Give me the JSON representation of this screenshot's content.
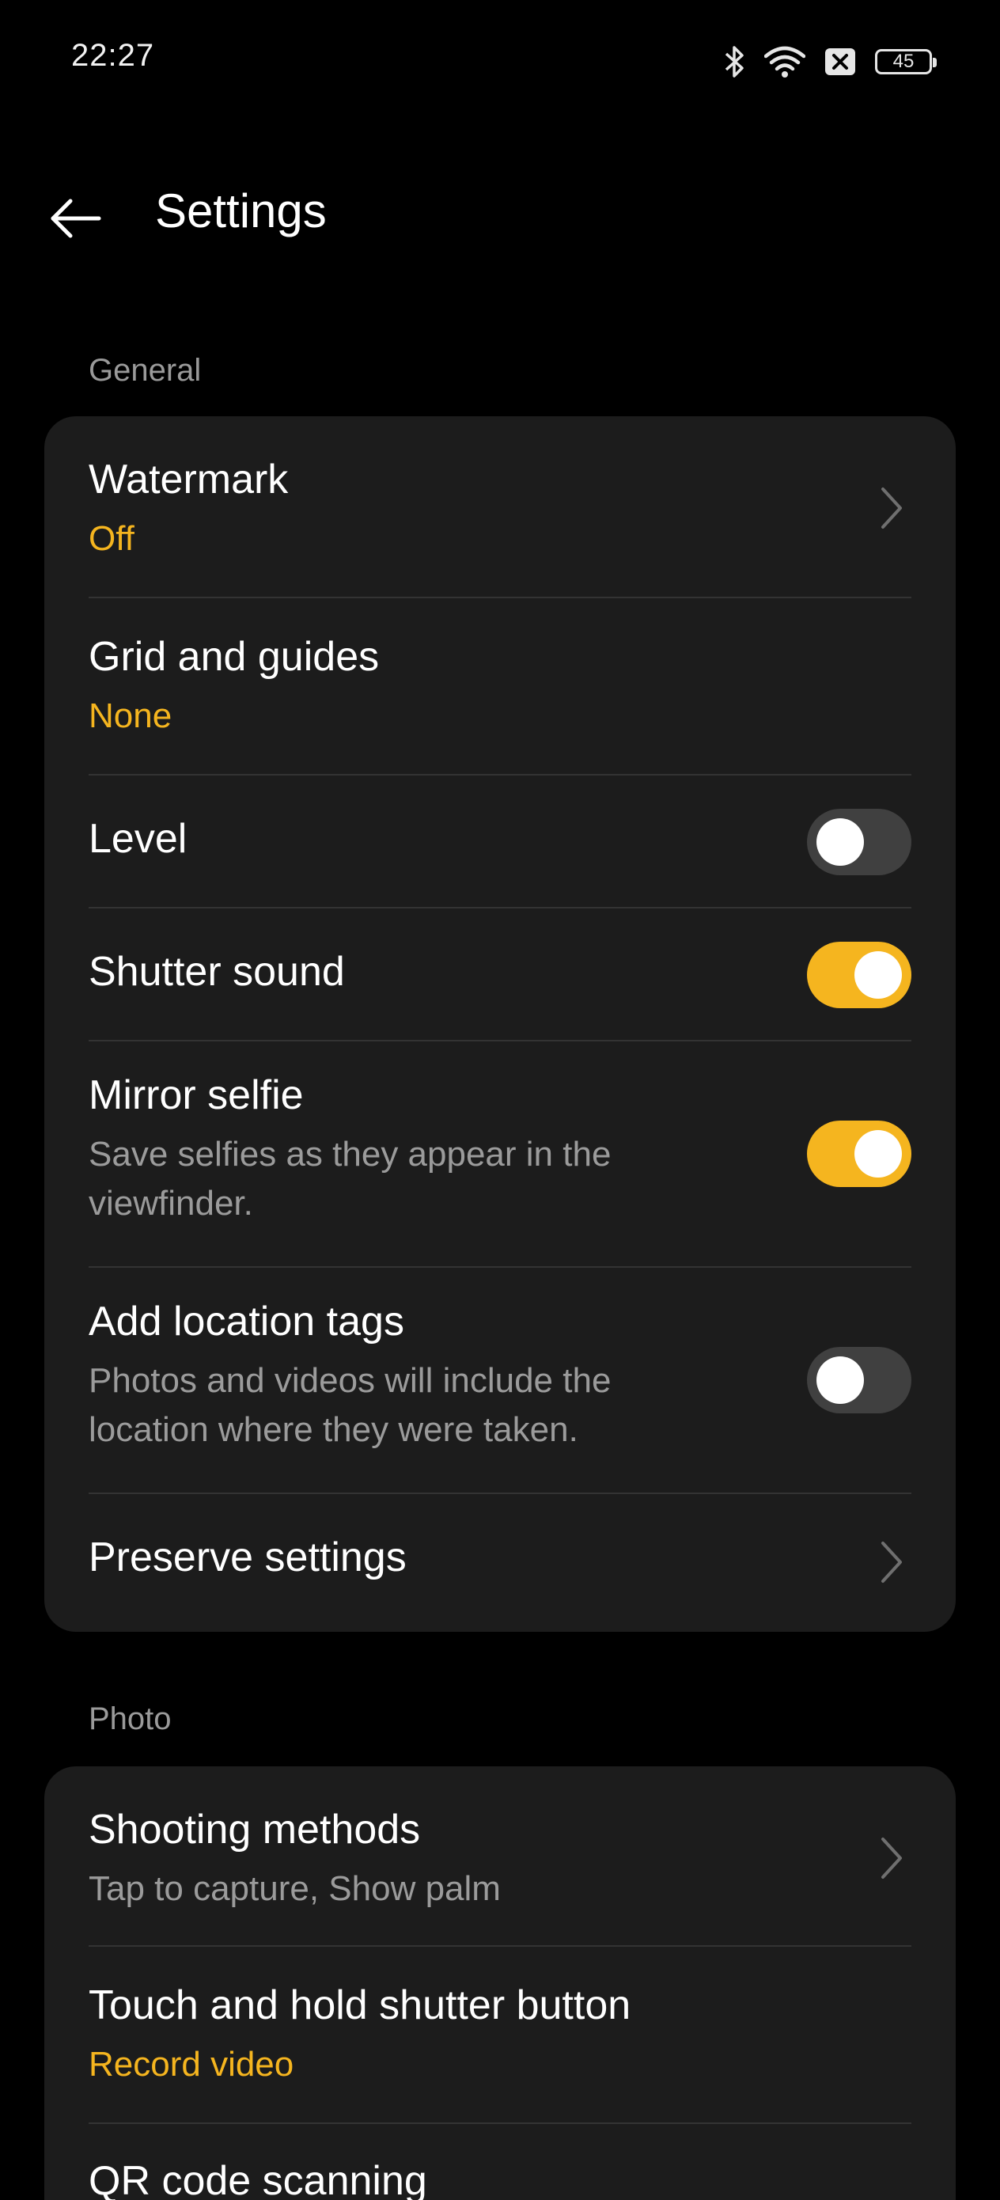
{
  "status_bar": {
    "time": "22:27",
    "battery": "45",
    "icons": [
      "bluetooth-icon",
      "wifi-icon",
      "sim-off-icon",
      "battery-icon"
    ]
  },
  "app_bar": {
    "title": "Settings",
    "back_icon": "arrow-left-icon"
  },
  "colors": {
    "accent": "#f5b51f",
    "card": "#1c1c1c",
    "background": "#000000",
    "muted_text": "#9b9b9b",
    "toggle_off": "#404040"
  },
  "sections": [
    {
      "label": "General",
      "items": [
        {
          "title": "Watermark",
          "value": "Off",
          "control": "chevron"
        },
        {
          "title": "Grid and guides",
          "value": "None",
          "control": "none"
        },
        {
          "title": "Level",
          "control": "toggle",
          "state": "off"
        },
        {
          "title": "Shutter sound",
          "control": "toggle",
          "state": "on"
        },
        {
          "title": "Mirror selfie",
          "description": "Save selfies as they appear in the viewfinder.",
          "control": "toggle",
          "state": "on"
        },
        {
          "title": "Add location tags",
          "description": "Photos and videos will include the location where they were taken.",
          "control": "toggle",
          "state": "off"
        },
        {
          "title": "Preserve settings",
          "control": "chevron"
        }
      ]
    },
    {
      "label": "Photo",
      "items": [
        {
          "title": "Shooting methods",
          "description": "Tap to capture, Show palm",
          "control": "chevron"
        },
        {
          "title": "Touch and hold shutter button",
          "value": "Record video",
          "control": "none"
        },
        {
          "title": "QR code scanning",
          "control": "none"
        }
      ]
    }
  ]
}
